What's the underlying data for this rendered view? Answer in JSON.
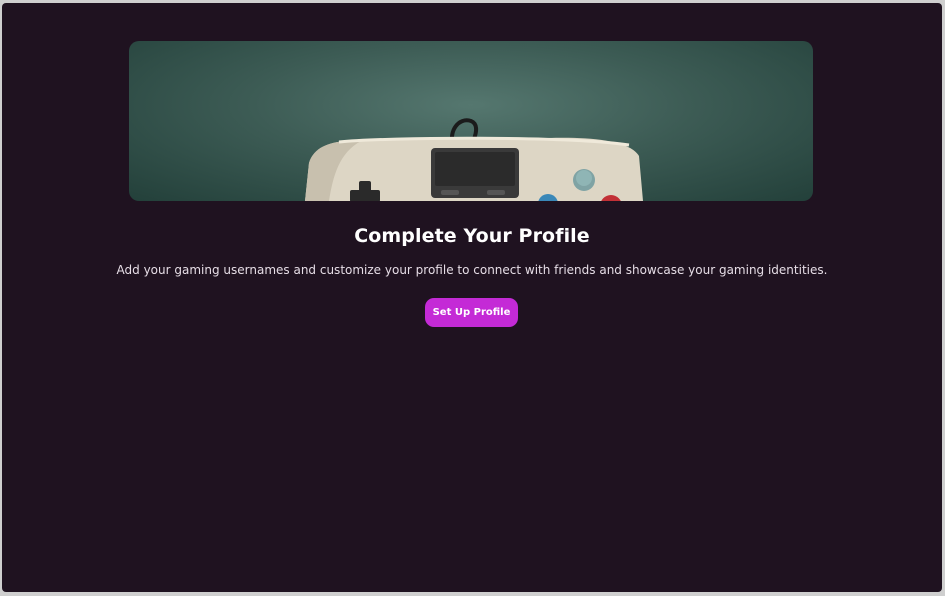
{
  "profile_prompt": {
    "title": "Complete Your Profile",
    "description": "Add your gaming usernames and customize your profile to connect with friends and showcase your gaming identities.",
    "cta_label": "Set Up Profile"
  },
  "hero_image": {
    "icon": "game-controller-icon"
  },
  "colors": {
    "background": "#1f1220",
    "accent": "#c42ad6",
    "text": "#ffffff"
  }
}
